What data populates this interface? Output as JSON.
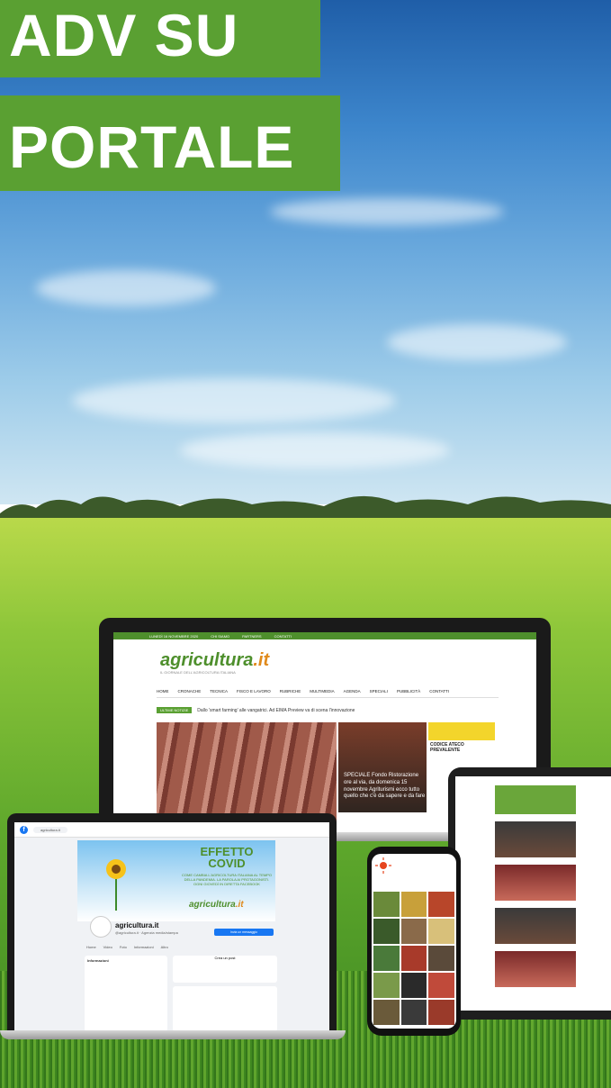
{
  "banner": {
    "line1": "ADV SU",
    "line2": "PORTALE"
  },
  "colors": {
    "brand_green": "#5aa032",
    "sky": "#3d86cc",
    "field": "#8dc63a",
    "accent_orange": "#e08a1c"
  },
  "laptop": {
    "topbar": [
      "LUNEDÌ 16 NOVEMBRE 2020",
      "CHI SIAMO",
      "PARTNERS",
      "CONTATTI"
    ],
    "logo_main": "agricultura",
    "logo_suffix": ".it",
    "tagline": "IL GIORNALE DELL'AGRICOLTURA ITALIANA",
    "nav": [
      "HOME",
      "CRONACHE",
      "TECNICA",
      "FISCO E LAVORO",
      "RUBRICHE",
      "MULTIMEDIA",
      "AGENDA",
      "SPECIALI",
      "PUBBLICITÀ",
      "CONTATTI"
    ],
    "news_label": "ULTIME NOTIZIE",
    "news_text": "Dallo 'smart farming' alle vangatrici. Ad EIMA Preview va di scena l'innovazione",
    "hero_caption": "SPECIALE Fondo Ristorazione ore al via, da domenica 15 novembre Agriturismi ecco tutto quello che c'è da sapere e da fare",
    "codice": "CODICE ATECO PREVALENTE"
  },
  "facebook": {
    "search": "agricultura.it",
    "cover_title": "EFFETTO COVID",
    "cover_sub": "COME CAMBIA L'AGRICOLTURA ITALIANA AL TEMPO DELLA PANDEMIA. LA PAROLA AI PROTAGONISTI. OGNI GIOVEDÌ IN DIRETTA FACEBOOK",
    "cover_logo": "agricultura",
    "cover_logo_suffix": ".it",
    "page_name": "agricultura.it",
    "category": "@agricultura.it · Agenzia media/stampa",
    "message_btn": "Invia un messaggio",
    "tabs": [
      "Home",
      "Video",
      "Foto",
      "Informazioni",
      "Altro"
    ],
    "info_title": "Informazioni",
    "create_post": "Crea un post"
  }
}
